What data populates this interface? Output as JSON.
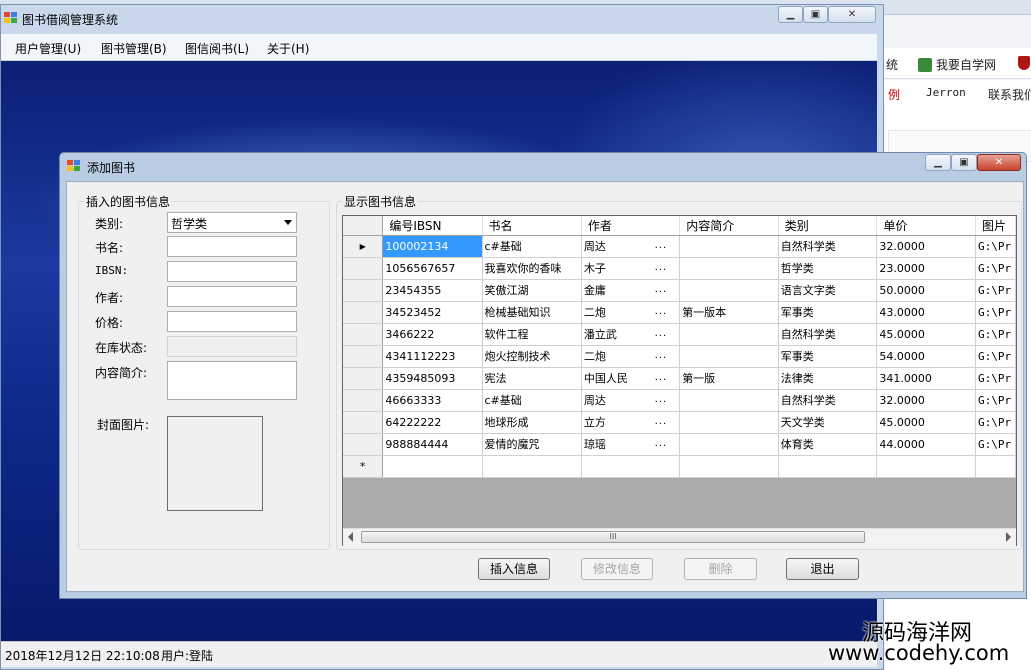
{
  "background": {
    "links": [
      "统",
      "我要自学网"
    ],
    "links2": [
      "例",
      "Jerron",
      "联系我们"
    ]
  },
  "main_window": {
    "title": "图书借阅管理系统",
    "menu": [
      "用户管理(U)",
      "图书管理(B)",
      "图信阅书(L)",
      "关于(H)"
    ],
    "status": {
      "datetime": "2018年12月12日  22:10:08",
      "user": "用户:登陆"
    }
  },
  "dialog": {
    "title": "添加图书",
    "left_group": {
      "label": "插入的图书信息",
      "category_label": "类别:",
      "category_value": "哲学类",
      "name_label": "书名:",
      "isbn_label": "IBSN:",
      "author_label": "作者:",
      "price_label": "价格:",
      "stock_label": "在库状态:",
      "intro_label": "内容简介:",
      "cover_label": "封面图片:"
    },
    "right_group": {
      "label": "显示图书信息"
    },
    "grid": {
      "columns": [
        "编号IBSN",
        "书名",
        "作者",
        "内容简介",
        "类别",
        "单价",
        "图片"
      ],
      "rows": [
        [
          "100002134",
          "c#基础",
          "周达",
          "",
          "自然科学类",
          "32.0000",
          "G:\\Pr"
        ],
        [
          "1056567657",
          "我喜欢你的香味",
          "木子",
          "",
          "哲学类",
          "23.0000",
          "G:\\Pr"
        ],
        [
          "23454355",
          "笑傲江湖",
          "金庸",
          "",
          "语言文字类",
          "50.0000",
          "G:\\Pr"
        ],
        [
          "34523452",
          "枪械基础知识",
          "二炮",
          "第一版本",
          "军事类",
          "43.0000",
          "G:\\Pr"
        ],
        [
          "3466222",
          "软件工程",
          "潘立武",
          "",
          "自然科学类",
          "45.0000",
          "G:\\Pr"
        ],
        [
          "4341112223",
          "炮火控制技术",
          "二炮",
          "",
          "军事类",
          "54.0000",
          "G:\\Pr"
        ],
        [
          "4359485093",
          "宪法",
          "中国人民",
          "第一版",
          "法律类",
          "341.0000",
          "G:\\Pr"
        ],
        [
          "46663333",
          "c#基础",
          "周达",
          "",
          "自然科学类",
          "32.0000",
          "G:\\Pr"
        ],
        [
          "64222222",
          "地球形成",
          "立方",
          "",
          "天文学类",
          "45.0000",
          "G:\\Pr"
        ],
        [
          "988884444",
          "爱情的魔咒",
          "琼瑶",
          "",
          "体育类",
          "44.0000",
          "G:\\Pr"
        ]
      ],
      "ellipsis": "...",
      "new_row_marker": "*",
      "current_row_marker": "▶",
      "scroll_thumb_grip": "III"
    },
    "buttons": {
      "insert": "插入信息",
      "modify": "修改信息",
      "delete": "删除",
      "exit": "退出"
    }
  },
  "watermark": {
    "line1": "源码海洋网",
    "line2": "www.codehy.com"
  },
  "colors": {
    "selection": "#3399ff",
    "desktop": "#0b1f74"
  }
}
